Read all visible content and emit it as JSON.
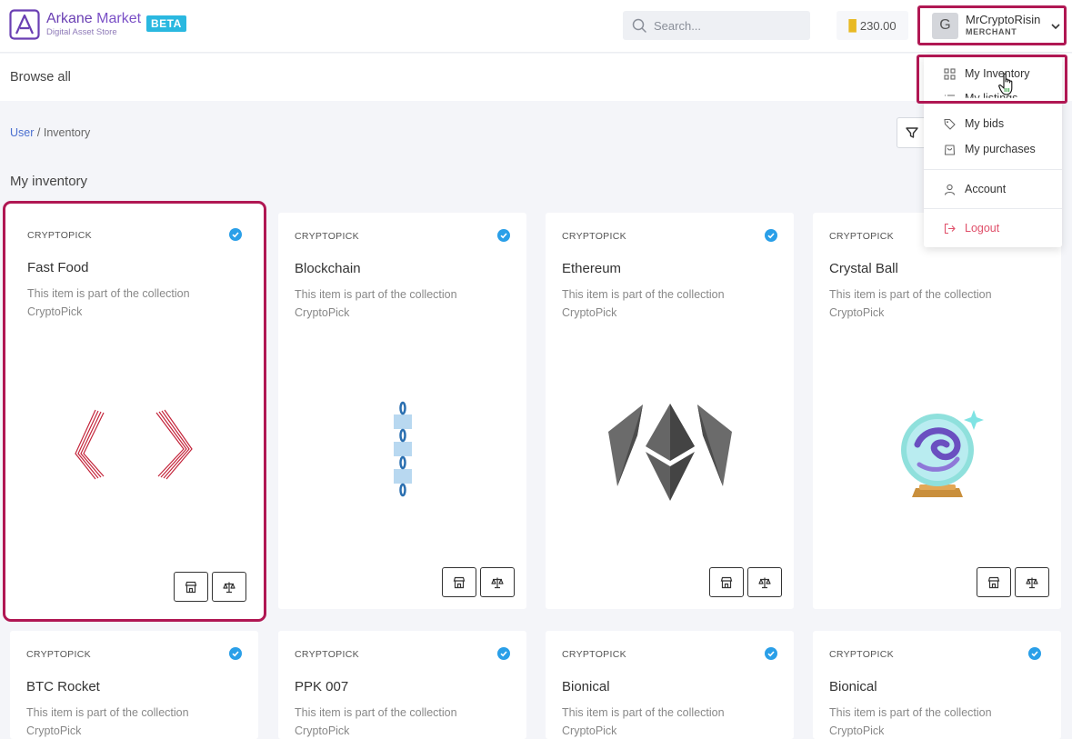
{
  "brand": {
    "name_part1": "Arkane",
    "name_part2": "Market",
    "tagline": "Digital Asset Store",
    "badge": "BETA"
  },
  "search": {
    "placeholder": "Search..."
  },
  "balance": {
    "amount": "230.00"
  },
  "user": {
    "initial": "G",
    "name": "MrCryptoRisin",
    "role": "MERCHANT"
  },
  "subnav": {
    "browse_label": "Browse all"
  },
  "breadcrumb": {
    "parent": "User",
    "separator": "/",
    "current": "Inventory"
  },
  "page": {
    "title": "My inventory"
  },
  "menu": {
    "items": [
      {
        "label": "My Inventory",
        "icon": "grid-icon"
      },
      {
        "label": "My listings",
        "icon": "list-icon"
      },
      {
        "label": "My bids",
        "icon": "tag-icon"
      },
      {
        "label": "My purchases",
        "icon": "bag-icon"
      },
      {
        "label": "Account",
        "icon": "user-icon"
      },
      {
        "label": "Logout",
        "icon": "logout-icon"
      }
    ]
  },
  "cards": [
    {
      "collection": "CRYPTOPICK",
      "name": "Fast Food",
      "desc_line1": "This item is part of the collection",
      "desc_line2": "CryptoPick",
      "art": "straws-icon"
    },
    {
      "collection": "CRYPTOPICK",
      "name": "Blockchain",
      "desc_line1": "This item is part of the collection",
      "desc_line2": "CryptoPick",
      "art": "chain-icon"
    },
    {
      "collection": "CRYPTOPICK",
      "name": "Ethereum",
      "desc_line1": "This item is part of the collection",
      "desc_line2": "CryptoPick",
      "art": "ethereum-icon"
    },
    {
      "collection": "CRYPTOPICK",
      "name": "Crystal Ball",
      "desc_line1": "This item is part of the collection",
      "desc_line2": "CryptoPick",
      "art": "crystal-ball-icon"
    },
    {
      "collection": "CRYPTOPICK",
      "name": "BTC Rocket",
      "desc_line1": "This item is part of the collection",
      "desc_line2": "CryptoPick"
    },
    {
      "collection": "CRYPTOPICK",
      "name": "PPK 007",
      "desc_line1": "This item is part of the collection",
      "desc_line2": "CryptoPick"
    },
    {
      "collection": "CRYPTOPICK",
      "name": "Bionical",
      "desc_line1": "This item is part of the collection",
      "desc_line2": "CryptoPick"
    },
    {
      "collection": "CRYPTOPICK",
      "name": "Bionical",
      "desc_line1": "This item is part of the collection",
      "desc_line2": "CryptoPick"
    }
  ],
  "colors": {
    "accent": "#b01753",
    "brand": "#6a3fb3",
    "badge": "#2ab8e0",
    "verified": "#2a9fe8",
    "logout": "#e0506a"
  }
}
